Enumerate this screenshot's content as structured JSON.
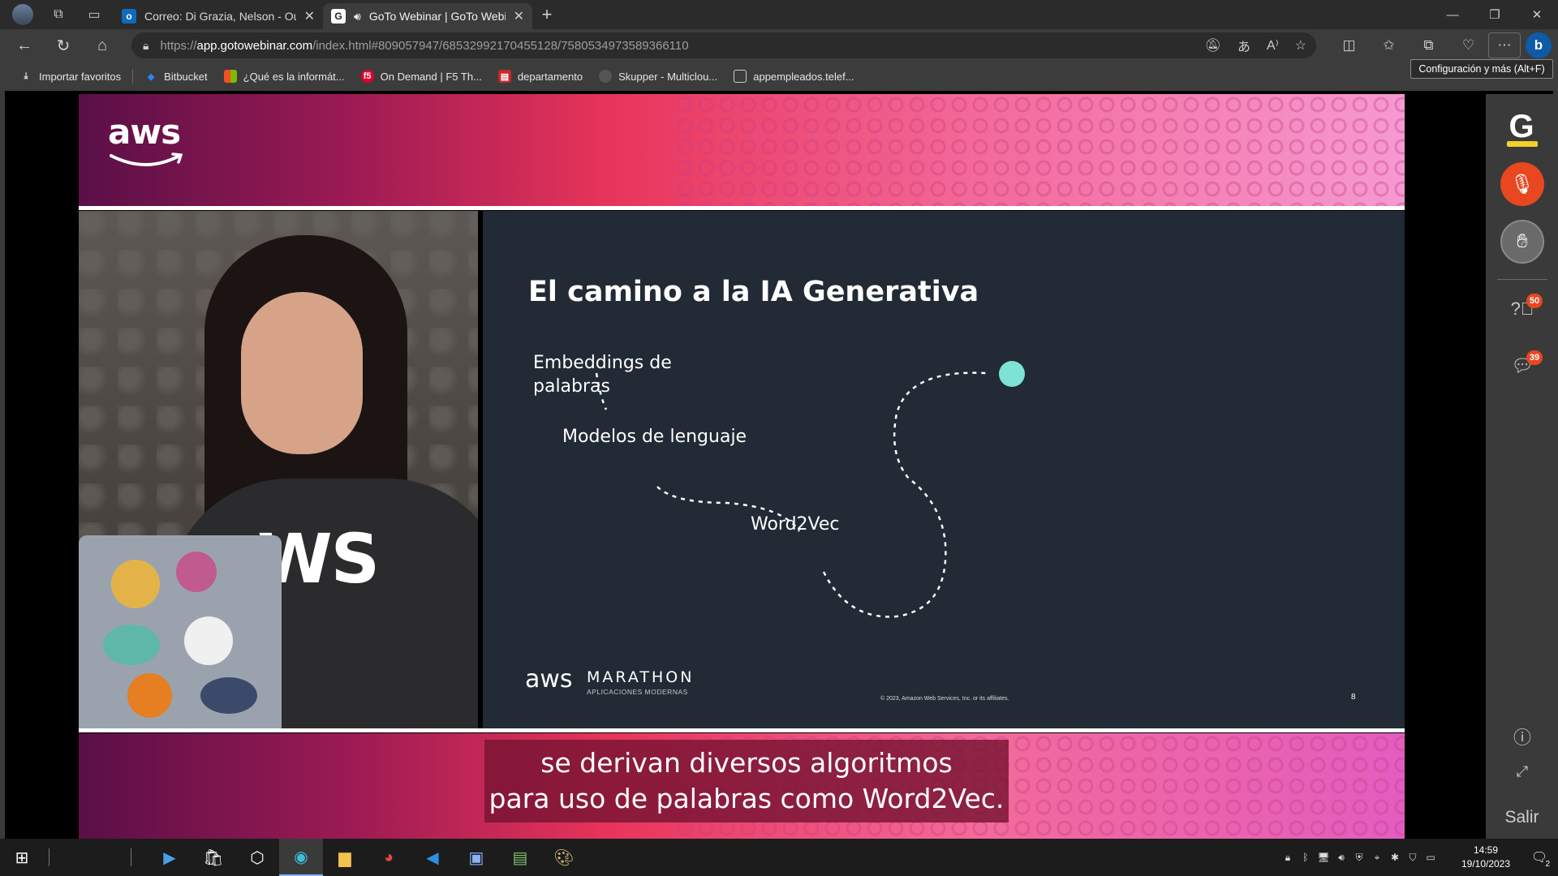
{
  "browser": {
    "tabs": [
      {
        "title": "Correo: Di Grazia, Nelson - Outlo",
        "favicon": "outlook-icon",
        "active": false
      },
      {
        "title": "GoTo Webinar | GoTo Webin",
        "favicon": "goto-icon",
        "active": true
      }
    ],
    "url": {
      "scheme": "https://",
      "host": "app.gotowebinar.com",
      "path": "/index.html#809057947/6853299217045512 8/7580534973589366110"
    },
    "url_full_path": "/index.html#809057947/68532992170455128/7580534973589366110",
    "tooltip": "Configuración y más (Alt+F)",
    "bookmarks": [
      {
        "label": "Importar favoritos",
        "icon": "import-icon"
      },
      {
        "label": "Bitbucket",
        "icon": "bitbucket-icon"
      },
      {
        "label": "¿Qué es la informát...",
        "icon": "microsoft-icon"
      },
      {
        "label": "On Demand | F5 Th...",
        "icon": "f5-icon"
      },
      {
        "label": "departamento",
        "icon": "pdf-icon"
      },
      {
        "label": "Skupper - Multiclou...",
        "icon": "skupper-icon"
      },
      {
        "label": "appempleados.telef...",
        "icon": "page-icon"
      }
    ]
  },
  "stream": {
    "brand": "aws",
    "slide": {
      "title": "El camino a la IA Generativa",
      "labels": {
        "embeddings_1": "Embeddings de",
        "embeddings_2": "palabras",
        "modelos": "Modelos de lenguaje",
        "word2vec": "Word2Vec"
      },
      "footer_brand": "aws",
      "footer_title": "MARATHON",
      "footer_sub": "APLICACIONES MODERNAS",
      "copyright": "© 2023, Amazon Web Services, Inc. or its affiliates.",
      "page_number": "8",
      "accent_color": "#7de3d4"
    },
    "shirt_text": "WS",
    "caption": {
      "line1": "se derivan diversos algoritmos",
      "line2": "para uso de palabras como Word2Vec."
    }
  },
  "webinar_panel": {
    "logo": "G",
    "questions_badge": "50",
    "chat_badge": "39",
    "exit_label": "Salir"
  },
  "taskbar": {
    "time": "14:59",
    "date": "19/10/2023",
    "notifications": "2"
  }
}
